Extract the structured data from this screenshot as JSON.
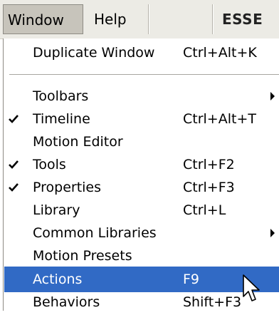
{
  "menubar": {
    "window": "Window",
    "help": "Help",
    "workspace": "ESSE"
  },
  "menu": {
    "duplicate_window": {
      "label": "Duplicate Window",
      "shortcut": "Ctrl+Alt+K"
    },
    "toolbars": {
      "label": "Toolbars",
      "submenu": true
    },
    "timeline": {
      "label": "Timeline",
      "shortcut": "Ctrl+Alt+T",
      "checked": true
    },
    "motion_editor": {
      "label": "Motion Editor"
    },
    "tools": {
      "label": "Tools",
      "shortcut": "Ctrl+F2",
      "checked": true
    },
    "properties": {
      "label": "Properties",
      "shortcut": "Ctrl+F3",
      "checked": true
    },
    "library": {
      "label": "Library",
      "shortcut": "Ctrl+L"
    },
    "common_libraries": {
      "label": "Common Libraries",
      "submenu": true
    },
    "motion_presets": {
      "label": "Motion Presets"
    },
    "actions": {
      "label": "Actions",
      "shortcut": "F9",
      "highlighted": true
    },
    "behaviors": {
      "label": "Behaviors",
      "shortcut": "Shift+F3"
    }
  },
  "colors": {
    "menubar_bg": "#ecebe5",
    "highlight": "#316ac5",
    "highlight_text": "#ffffff"
  },
  "icons": {
    "check": "check-icon",
    "submenu": "chevron-right-icon",
    "cursor": "mouse-pointer-icon"
  }
}
